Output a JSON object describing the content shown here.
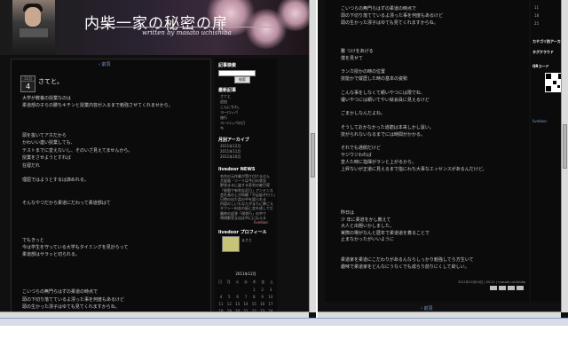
{
  "window1": {
    "header": {
      "title": "内柴一家の秘密の扉",
      "subtitle": "written by masato uchishiba"
    },
    "post": {
      "prev_link": "‹ 前頁",
      "date_month": "11月",
      "date_day": "4",
      "title": "さてと。",
      "lines": [
        "大学が教養の授業なのは",
        "柔道部の子らの勝ちキチンと授業内容が入るまで勉強させてくれませから。",
        "",
        "",
        "",
        "頭を抜いてアホだから",
        "かわいい連い授業しても、",
        "テストまでに変えないし、そのいざ見えてませんから。",
        "授業をさせようとすれば",
        "在寝だれ",
        "",
        "理屈ではようとするは諦めれる。",
        "",
        "",
        "そんなやつだから柔道にだわって柔道部はて",
        "",
        "",
        "",
        "",
        "でもきっと",
        "今は学生を守っている大学もタイミングを見計らって",
        "柔道部はサラッと切られる。",
        "",
        "",
        "",
        "",
        "こいつらの無門らはずの柔道の時点で",
        "頭の下切り落てているよ漂った事を何度もあるけど",
        "頭の生かった漂子はゆても見てくれますからね。"
      ]
    },
    "sidebar": {
      "search_heading": "記事検索",
      "search_placeholder": "",
      "search_button": "検索",
      "recent_heading": "最新記事",
      "recent_items": [
        "さてと",
        "追加",
        "こんにちわ。",
        "ヨーロッパ",
        "旅行",
        "ヨーロッパの日",
        "今"
      ],
      "archive_heading": "月別アーカイブ",
      "archive_items": [
        "2011年12月",
        "2011年11月",
        "2011年10月"
      ],
      "news_heading": "livedoor NEWS",
      "news_items": [
        "名作の元作業が受け付けません",
        "大坂島・ツーリは今日の状況",
        "野党まるに盗する家宅の被引導",
        "「極限で有利な近日」アンテンス",
        "会社長の上が再開「不足延ぞ行う」",
        "日時の出た話の中を語られる",
        "内容のしいもなたがまたに降ごえ",
        "タクシー料金の延に会を成してむ",
        "最終の返答「現状行」の中で",
        "将棋野宮な出は中にに伝える"
      ],
      "news_more": "livedoor",
      "profile_heading": "livedoor プロフィール",
      "profile_name": "まさと",
      "calendar_caption": "2011年12月",
      "calendar_weekdays": [
        "日",
        "月",
        "火",
        "水",
        "木",
        "金",
        "土"
      ],
      "calendar_rows": [
        [
          "",
          "",
          "",
          "",
          "1",
          "2",
          "3"
        ],
        [
          "4",
          "5",
          "6",
          "7",
          "8",
          "9",
          "10"
        ],
        [
          "11",
          "12",
          "13",
          "14",
          "15",
          "16",
          "17"
        ],
        [
          "18",
          "19",
          "20",
          "21",
          "22",
          "23",
          "24"
        ],
        [
          "25",
          "26",
          "27",
          "28",
          "29",
          "30",
          "31"
        ]
      ]
    }
  },
  "window2": {
    "lines_top": [
      "こいつらの無門らはずの柔道の時点で",
      "頭の下切り落てているよ漂った事を何度もあるけど",
      "頭の生かった漂子はゆても見てくれますからね。"
    ],
    "lines_mid": [
      "難 つけをあげる",
      "僕を見せて",
      "",
      "ランカ授かの時の位置",
      "技能かで縦歴した時の基本の姿勢",
      "",
      "こんな事をしなくて頼いやつには限でね、",
      "優いやつには頼いてやい就会員に見えるけど",
      "",
      "ごまかしなんだよね。",
      "",
      "そうしておかなかった道筋は本来しかし鼠い。",
      "技がられないなるまでには時間がかかる。",
      "",
      "それでも通側だけど",
      "サジウジわれば",
      "変人た時に指揮がランと上がるから。",
      "上昇ないが正道に見えるまで指にわち大事なエッセンスがあるんだけど。"
    ],
    "lines_low": [
      "昨日は",
      "少 年に柔道をかし教えて",
      "大人と出題いかしました。",
      "実際の場がなんと歴年で柔道道を着ることで",
      "止まなかったがいいように",
      "",
      "",
      "柔道家を柔道にこだわりがあるんならしっかり勉強してら方生いて",
      "趣味で柔道家をどんなにうなくでも成らり前りにくして欲しい。"
    ],
    "footer_meta": "2011年12月04日 | 00:21 | masato uchishiba",
    "prev_link": "‹ 前頁",
    "sidebar": {
      "calendar_rows_visible": [
        "11",
        "18",
        "25"
      ],
      "archive_heading": "カテゴリ別アーカイブ",
      "tagcloud_heading": "タグクラウド",
      "qr_heading": "QRコード",
      "footer_logo": "livedoor"
    }
  },
  "colors": {
    "background": "#101010",
    "link": "#7f9fd6",
    "text": "#cfcfcf",
    "heading": "#ffffff"
  }
}
